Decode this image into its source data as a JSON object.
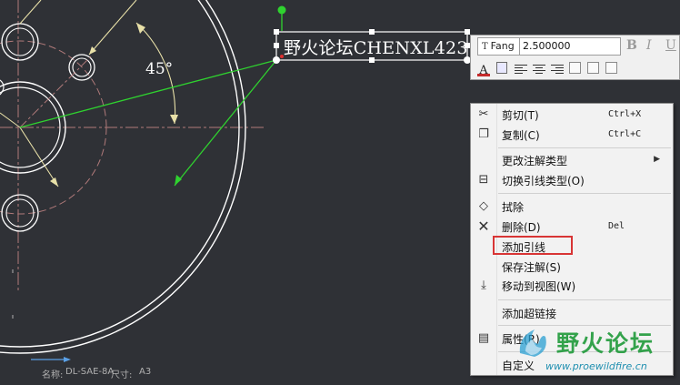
{
  "drawing": {
    "annotation_text": "野火论坛CHENXL423",
    "angle_label": "45°"
  },
  "toolbar": {
    "font_name": "Fang",
    "font_prefix": "T",
    "font_size": "2.500000",
    "bold": "B",
    "italic": "I",
    "underline": "U",
    "font_color_letter": "A",
    "colors": {
      "text_color": "#c42a2a"
    }
  },
  "context_menu": {
    "items": [
      {
        "label": "剪切(T)",
        "shortcut": "Ctrl+X",
        "icon": "scissors-icon"
      },
      {
        "label": "复制(C)",
        "shortcut": "Ctrl+C",
        "icon": "copy-icon"
      },
      {
        "label": "更改注解类型",
        "icon": ""
      },
      {
        "label": "切换引线类型(O)",
        "icon": "leader-type-icon"
      },
      {
        "label": "拭除",
        "icon": "eraser-icon"
      },
      {
        "label": "删除(D)",
        "shortcut": "Del",
        "icon": "delete-x-icon"
      },
      {
        "label": "添加引线",
        "icon": ""
      },
      {
        "label": "保存注解(S)",
        "icon": ""
      },
      {
        "label": "移动到视图(W)",
        "icon": "move-to-view-icon"
      },
      {
        "label": "添加超链接",
        "icon": ""
      },
      {
        "label": "属性(R)",
        "icon": "properties-icon"
      },
      {
        "label": "自定义",
        "icon": ""
      }
    ],
    "highlight_color": "#d83535"
  },
  "status_bar": {
    "name_label": "名称:",
    "name_value": "DL-SAE-8A",
    "size_label": "尺寸:",
    "size_value": "A3"
  },
  "watermark": {
    "title": "野火论坛",
    "url": "www.proewildfire.cn"
  },
  "colors": {
    "background": "#2f3136",
    "leader_green": "#2fd22f",
    "geometry_white": "#ffffff",
    "construction_dashed": "#b07a7a",
    "dimension_yellow": "#e8e0a8"
  }
}
